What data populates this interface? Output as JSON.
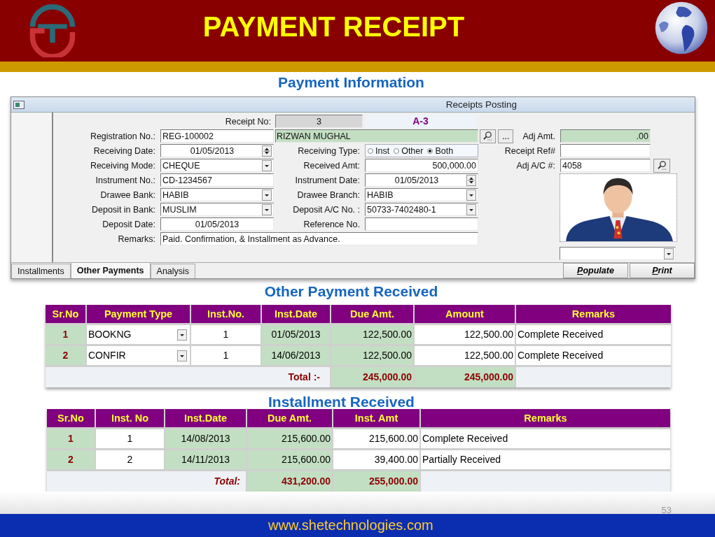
{
  "slide": {
    "title": "PAYMENT RECEIPT",
    "section_title": "Payment Information",
    "website": "www.shetechnologies.com",
    "page_number": "53"
  },
  "form": {
    "title": "Receipts Posting",
    "receipt_no": {
      "label": "Receipt No:",
      "value": "3"
    },
    "receipt_code": "A-3",
    "registration_no": {
      "label": "Registration No.:",
      "value": "REG-100002"
    },
    "customer_name": "RIZWAN MUGHAL",
    "browse_button": "...",
    "adj_amt": {
      "label": "Adj Amt.",
      "value": ".00"
    },
    "receiving_date": {
      "label": "Receiving Date:",
      "value": "01/05/2013"
    },
    "receiving_type": {
      "label": "Receiving Type:",
      "options": [
        {
          "label": "Inst",
          "selected": false
        },
        {
          "label": "Other",
          "selected": false
        },
        {
          "label": "Both",
          "selected": true
        }
      ]
    },
    "receipt_ref": {
      "label": "Receipt Ref#"
    },
    "receiving_mode": {
      "label": "Receiving Mode:",
      "value": "CHEQUE"
    },
    "received_amt": {
      "label": "Received Amt:",
      "value": "500,000.00"
    },
    "adj_ac": {
      "label": "Adj A/C #:",
      "value": "4058"
    },
    "instrument_no": {
      "label": "Instrument No.:",
      "value": "CD-1234567"
    },
    "instrument_date": {
      "label": "Instrument Date:",
      "value": "01/05/2013"
    },
    "drawee_bank": {
      "label": "Drawee Bank:",
      "value": "HABIB"
    },
    "drawee_branch": {
      "label": "Drawee Branch:",
      "value": "HABIB"
    },
    "deposit_bank": {
      "label": "Deposit in Bank:",
      "value": "MUSLIM"
    },
    "deposit_ac": {
      "label": "Deposit A/C No. :",
      "value": "50733-7402480-1"
    },
    "deposit_date": {
      "label": "Deposit Date:",
      "value": "01/05/2013"
    },
    "reference_no": {
      "label": "Reference No."
    },
    "remarks": {
      "label": "Remarks:",
      "value": "Paid. Confirmation, & Installment as Advance."
    },
    "tabs": [
      {
        "label": "Installments",
        "selected": false
      },
      {
        "label": "Other Payments",
        "selected": true
      },
      {
        "label": "Analysis",
        "selected": false
      }
    ],
    "buttons": [
      {
        "label": "Populate"
      },
      {
        "label": "Print"
      }
    ]
  },
  "tables": [
    {
      "title": "Other Payment Received",
      "columns": [
        {
          "label": "Sr.No",
          "kind": "serial"
        },
        {
          "label": "Payment Type",
          "kind": "select"
        },
        {
          "label": "Inst.No.",
          "kind": "number"
        },
        {
          "label": "Inst.Date",
          "kind": "date"
        },
        {
          "label": "Due Amt.",
          "kind": "due"
        },
        {
          "label": "Amount",
          "kind": "amount"
        },
        {
          "label": "Remarks",
          "kind": "text"
        }
      ],
      "rows": [
        [
          "1",
          "BOOKNG",
          "1",
          "01/05/2013",
          "122,500.00",
          "122,500.00",
          "Complete Received"
        ],
        [
          "2",
          "CONFIR",
          "1",
          "14/06/2013",
          "122,500.00",
          "122,500.00",
          "Complete Received"
        ]
      ],
      "total": {
        "label": "Total :-",
        "values": [
          "245,000.00",
          "245,000.00"
        ]
      }
    },
    {
      "title": "Installment Received",
      "columns": [
        {
          "label": "Sr.No",
          "kind": "serial"
        },
        {
          "label": "Inst. No",
          "kind": "number"
        },
        {
          "label": "Inst.Date",
          "kind": "date"
        },
        {
          "label": "Due Amt.",
          "kind": "due"
        },
        {
          "label": "Inst. Amt",
          "kind": "amount"
        },
        {
          "label": "Remarks",
          "kind": "text"
        }
      ],
      "rows": [
        [
          "1",
          "1",
          "14/08/2013",
          "215,600.00",
          "215,600.00",
          "Complete Received"
        ],
        [
          "2",
          "2",
          "14/11/2013",
          "215,600.00",
          "39,400.00",
          "Partially Received"
        ]
      ],
      "total": {
        "label": "Total:",
        "values": [
          "431,200.00",
          "255,000.00"
        ]
      }
    }
  ]
}
